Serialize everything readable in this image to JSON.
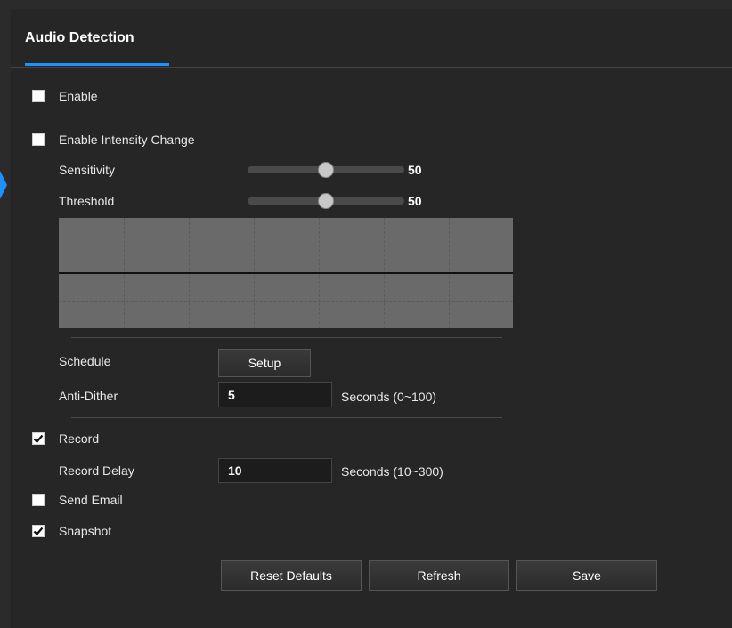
{
  "header": {
    "title": "Audio Detection"
  },
  "enable": {
    "label": "Enable",
    "checked": false
  },
  "enable_intensity": {
    "label": "Enable Intensity Change",
    "checked": false
  },
  "sensitivity": {
    "label": "Sensitivity",
    "value": "50",
    "level": 0.5
  },
  "threshold": {
    "label": "Threshold",
    "value": "50",
    "level": 0.5
  },
  "schedule": {
    "label": "Schedule",
    "button": "Setup"
  },
  "anti_dither": {
    "label": "Anti-Dither",
    "value": "5",
    "suffix": "Seconds (0~100)"
  },
  "record": {
    "label": "Record",
    "checked": true
  },
  "record_delay": {
    "label": "Record Delay",
    "value": "10",
    "suffix": "Seconds (10~300)"
  },
  "send_email": {
    "label": "Send Email",
    "checked": false
  },
  "snapshot": {
    "label": "Snapshot",
    "checked": true
  },
  "footer": {
    "reset_label": "Reset Defaults",
    "refresh_label": "Refresh",
    "save_label": "Save"
  },
  "colors": {
    "accent": "#1e90ff",
    "background": "#262626"
  },
  "icons": {
    "checkmark": "check-icon",
    "tab_marker": "triangle-right-icon"
  }
}
